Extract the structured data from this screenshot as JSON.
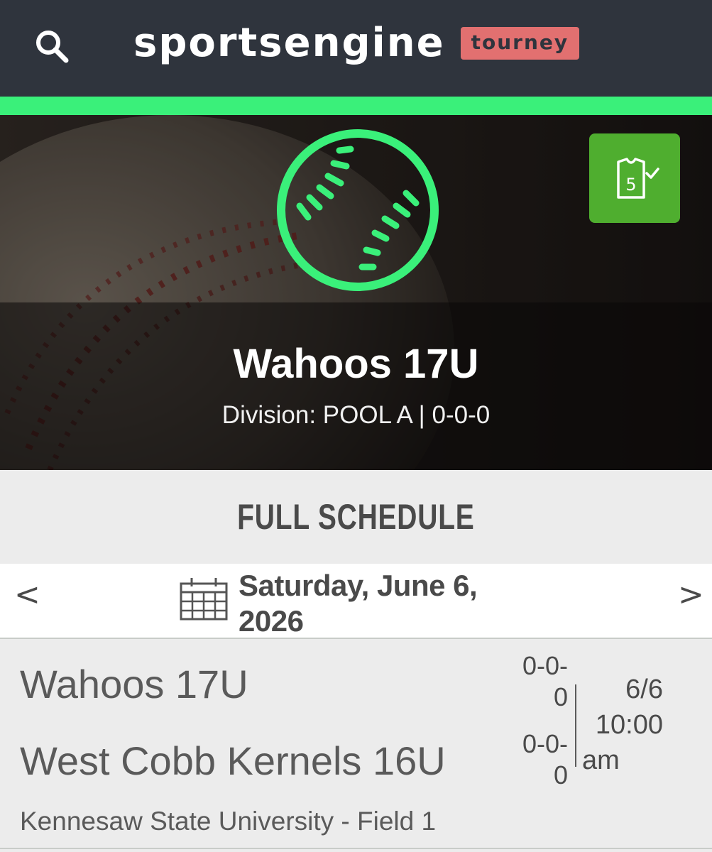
{
  "header": {
    "brand_name": "sportsengine",
    "brand_badge": "tourney",
    "search_icon": "search-icon"
  },
  "hero": {
    "sport_icon": "baseball-icon",
    "lineup_icon": "jersey-check-icon",
    "lineup_number": "5",
    "team_name": "Wahoos 17U",
    "subtitle": "Division: POOL A | 0-0-0"
  },
  "schedule": {
    "title": "FULL SCHEDULE",
    "prev_label": "<",
    "next_label": ">",
    "calendar_icon": "calendar-icon",
    "date_line1": "Saturday, June 6,",
    "date_line2": "2026"
  },
  "game": {
    "team1": "Wahoos 17U",
    "team1_record_line1": "0-0-",
    "team1_record_line2": "0",
    "team2": "West Cobb Kernels 16U",
    "team2_record_line1": "0-0-",
    "team2_record_line2": "0",
    "date": "6/6",
    "time_line1": "10:00",
    "time_line2": "am",
    "venue": "Kennesaw State University - Field 1"
  },
  "colors": {
    "topbar": "#2f343d",
    "accent_green": "#3af07a",
    "badge": "#e27070",
    "lineup_button": "#4fae2f"
  }
}
